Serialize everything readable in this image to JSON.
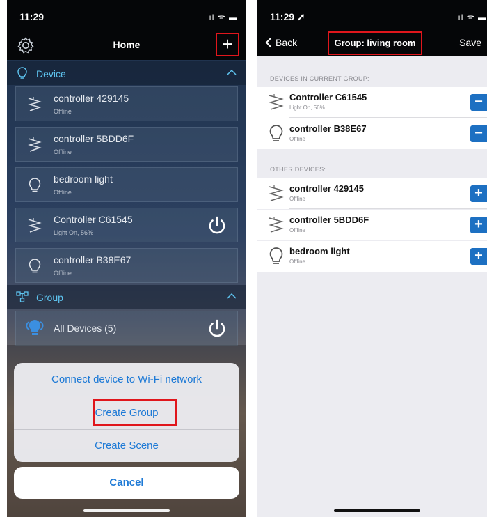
{
  "left": {
    "status": {
      "time": "11:29",
      "signal": "ıl ᯤ ▬"
    },
    "nav": {
      "title": "Home",
      "plus": "+"
    },
    "device_section": {
      "label": "Device"
    },
    "devices": [
      {
        "name": "controller 429145",
        "status": "Offline",
        "icon": "led-strip-icon"
      },
      {
        "name": "controller 5BDD6F",
        "status": "Offline",
        "icon": "led-strip-icon"
      },
      {
        "name": "bedroom light",
        "status": "Offline",
        "icon": "bulb-icon"
      },
      {
        "name": "Controller C61545",
        "status": "Light On, 56%",
        "icon": "led-strip-icon"
      },
      {
        "name": "controller B38E67",
        "status": "Offline",
        "icon": "bulb-icon"
      }
    ],
    "group_section": {
      "label": "Group"
    },
    "groups": [
      {
        "name": "All Devices (5)"
      }
    ],
    "sheet": {
      "options": [
        "Connect device to Wi-Fi network",
        "Create Group",
        "Create Scene"
      ],
      "cancel": "Cancel"
    }
  },
  "right": {
    "status": {
      "time": "11:29 ➚",
      "signal": "ıl ᯤ ▬"
    },
    "nav": {
      "back": "Back",
      "title": "Group: living room",
      "save": "Save"
    },
    "current_label": "DEVICES IN CURRENT GROUP:",
    "current_devices": [
      {
        "name": "Controller C61545",
        "status": "Light On, 56%",
        "action": "−"
      },
      {
        "name": "controller B38E67",
        "status": "Offline",
        "action": "−"
      }
    ],
    "other_label": "OTHER DEVICES:",
    "other_devices": [
      {
        "name": "controller 429145",
        "status": "Offline",
        "action": "+"
      },
      {
        "name": "controller 5BDD6F",
        "status": "Offline",
        "action": "+"
      },
      {
        "name": "bedroom light",
        "status": "Offline",
        "action": "+"
      }
    ]
  },
  "colors": {
    "accent": "#1e7ad6",
    "highlight": "#e0161c",
    "section": "#5ec4f0",
    "action": "#1d70c2"
  }
}
